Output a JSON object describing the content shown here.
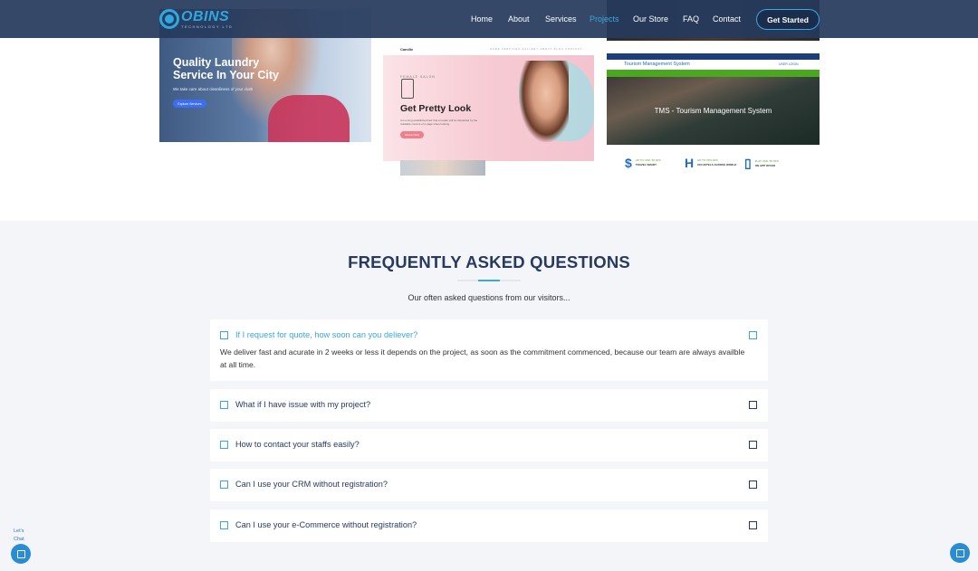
{
  "brand": {
    "name": "OBINS",
    "tagline": "TECHNOLOGY LTD",
    "accent": "#3aa7df",
    "navy": "#263a62"
  },
  "nav": {
    "items": [
      {
        "label": "Home",
        "active": false
      },
      {
        "label": "About",
        "active": false
      },
      {
        "label": "Services",
        "active": false
      },
      {
        "label": "Projects",
        "active": true
      },
      {
        "label": "Our Store",
        "active": false
      },
      {
        "label": "FAQ",
        "active": false
      },
      {
        "label": "Contact",
        "active": false
      }
    ],
    "cta_label": "Get Started"
  },
  "projects": {
    "laundry": {
      "title": "Quality Laundry Service In Your City",
      "subtitle": "We take care about cleanliness of your cloth",
      "button": "Explore Services"
    },
    "salon": {
      "logo": "Camille",
      "links": "HOME  SERVICES  GALLERY  ABOUT  BLOG  CONTACT",
      "kicker": "FEMALE SALON",
      "title": "Get Pretty Look",
      "description": "It is a long established fact that a reader will be distracted by the readable content of a page when looking",
      "button": "Discover More"
    },
    "tms": {
      "header": "Tourism Management System",
      "login": "USER LOGIN",
      "title": "TMS - Tourism Management System",
      "features": [
        {
          "icon": "$",
          "line1": "UP TO USD. 50 OFF",
          "line2": "TRAVEL SMART"
        },
        {
          "icon": "H",
          "line1": "UP TO 70% OFF",
          "line2": "ON HOTELS ACROSS WORLD"
        },
        {
          "icon": "▯",
          "line1": "FLAT USD. 50 OFF",
          "line2": "ON APP OFFER"
        }
      ]
    }
  },
  "faq": {
    "title": "FREQUENTLY ASKED QUESTIONS",
    "subtitle": "Our often asked questions from our visitors...",
    "items": [
      {
        "question": "If I request for quote, how soon can you deliever?",
        "answer": "We deliver fast and acurate in 2 weeks or less it depends on the project, as soon as the commitment commenced, because our team are always availble at all time.",
        "open": true
      },
      {
        "question": "What if I have issue with my project?",
        "open": false
      },
      {
        "question": "How to contact your staffs easily?",
        "open": false
      },
      {
        "question": "Can I use your CRM without registration?",
        "open": false
      },
      {
        "question": "Can I use your e-Commerce without registration?",
        "open": false
      }
    ]
  },
  "chat": {
    "label_line1": "Let's",
    "label_line2": "Chat"
  }
}
